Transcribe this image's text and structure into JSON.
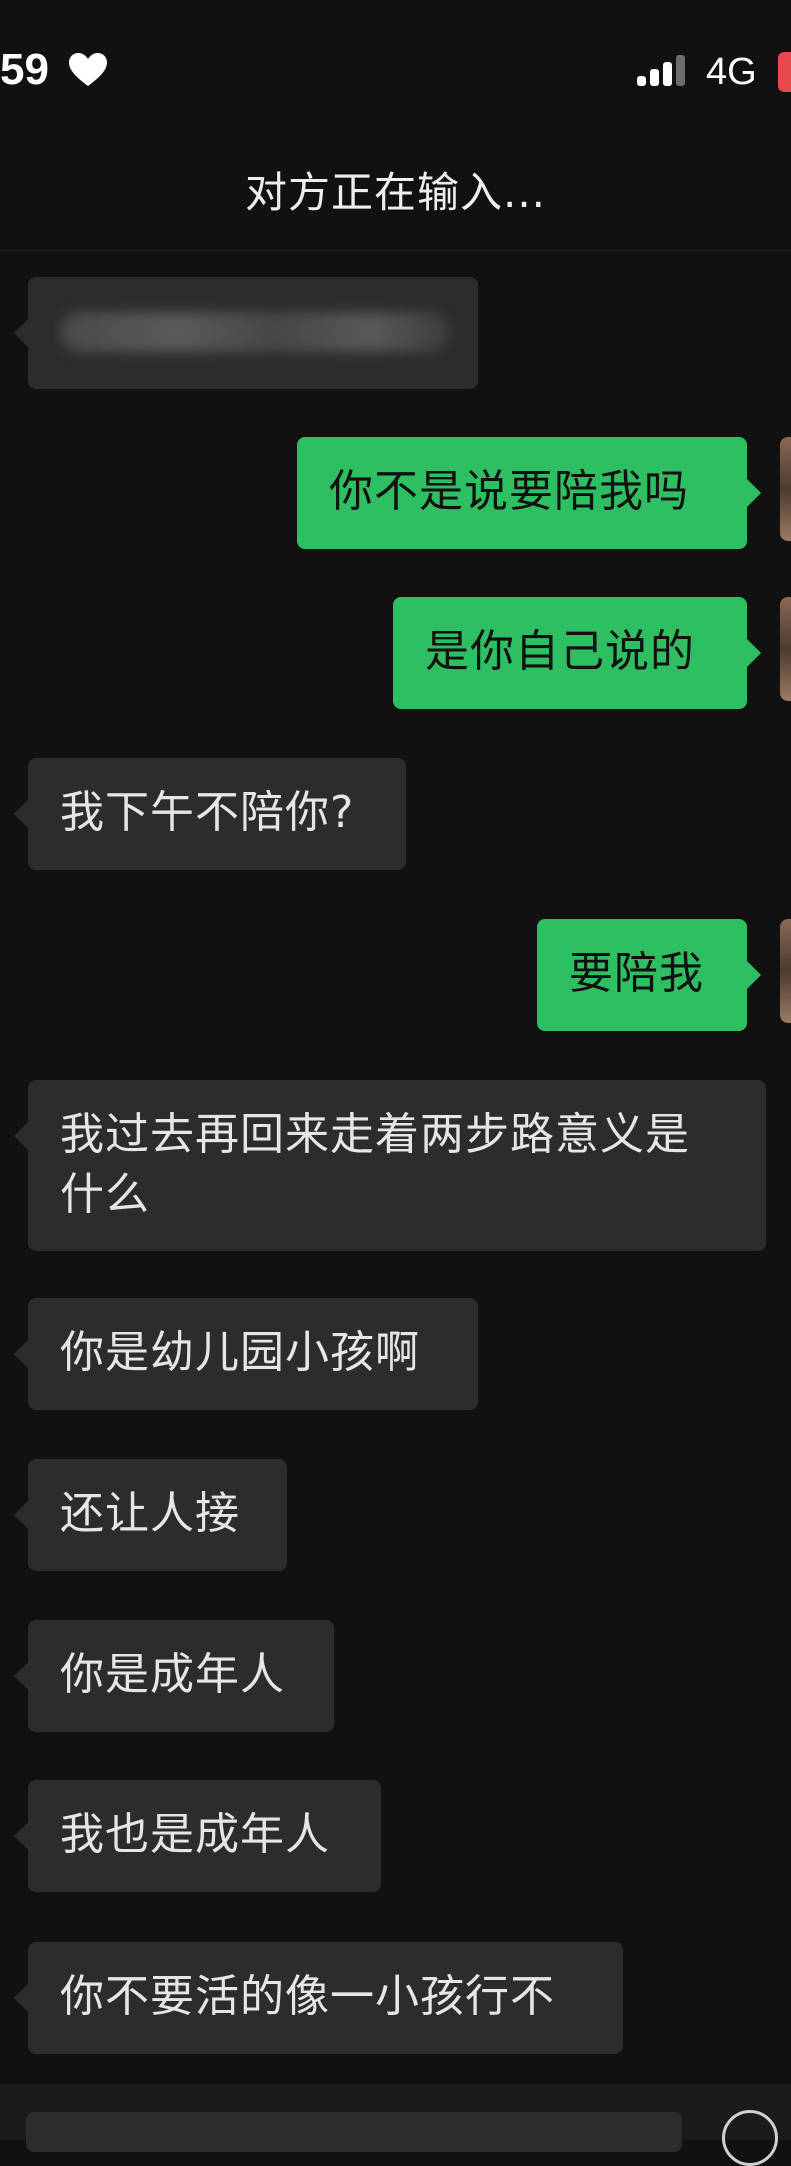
{
  "status_bar": {
    "time": "59",
    "network": "4G",
    "icons": [
      "heart-icon",
      "signal-icon",
      "battery-icon"
    ]
  },
  "chat": {
    "title": "对方正在输入...",
    "messages": [
      {
        "from": "them",
        "text": ""
      },
      {
        "from": "me",
        "text": "你不是说要陪我吗"
      },
      {
        "from": "me",
        "text": "是你自己说的"
      },
      {
        "from": "them",
        "text": "我下午不陪你?"
      },
      {
        "from": "me",
        "text": "要陪我"
      },
      {
        "from": "them",
        "text": "我过去再回来走着两步路意义是什么"
      },
      {
        "from": "them",
        "text": "你是幼儿园小孩啊"
      },
      {
        "from": "them",
        "text": "还让人接"
      },
      {
        "from": "them",
        "text": "你是成年人"
      },
      {
        "from": "them",
        "text": "我也是成年人"
      },
      {
        "from": "them",
        "text": "你不要活的像一小孩行不"
      }
    ]
  },
  "colors": {
    "background": "#111111",
    "incoming_bubble": "#2c2c2c",
    "outgoing_bubble": "#2fbf63"
  }
}
